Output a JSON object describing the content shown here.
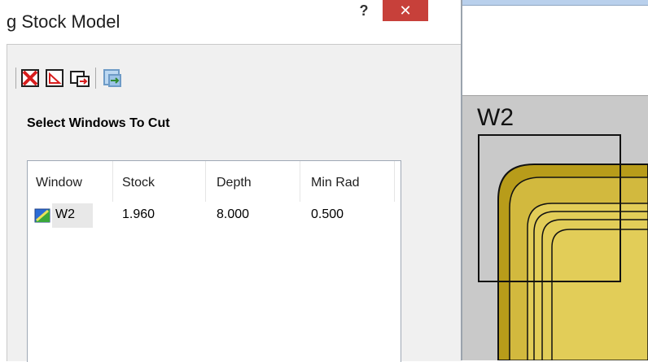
{
  "dialog": {
    "title": "g Stock Model",
    "help_label": "?",
    "close_label": "✕"
  },
  "toolbar": {
    "buttons": [
      {
        "icon": "delete-window-icon"
      },
      {
        "icon": "select-window-icon"
      },
      {
        "icon": "add-window-icon"
      },
      {
        "icon": "cut-stock-icon"
      }
    ]
  },
  "section": {
    "heading": "Select Windows To Cut"
  },
  "window_list": {
    "columns": [
      "Window",
      "Stock",
      "Depth",
      "Min Rad"
    ],
    "rows": [
      {
        "window": "W2",
        "stock": "1.960",
        "depth": "8.000",
        "min_rad": "0.500"
      }
    ]
  },
  "viewport": {
    "window_label": "W2",
    "colors": {
      "stock_fill": "#e0cb54",
      "stock_shade": "#b89c1a",
      "background": "#c9c9c9"
    }
  }
}
